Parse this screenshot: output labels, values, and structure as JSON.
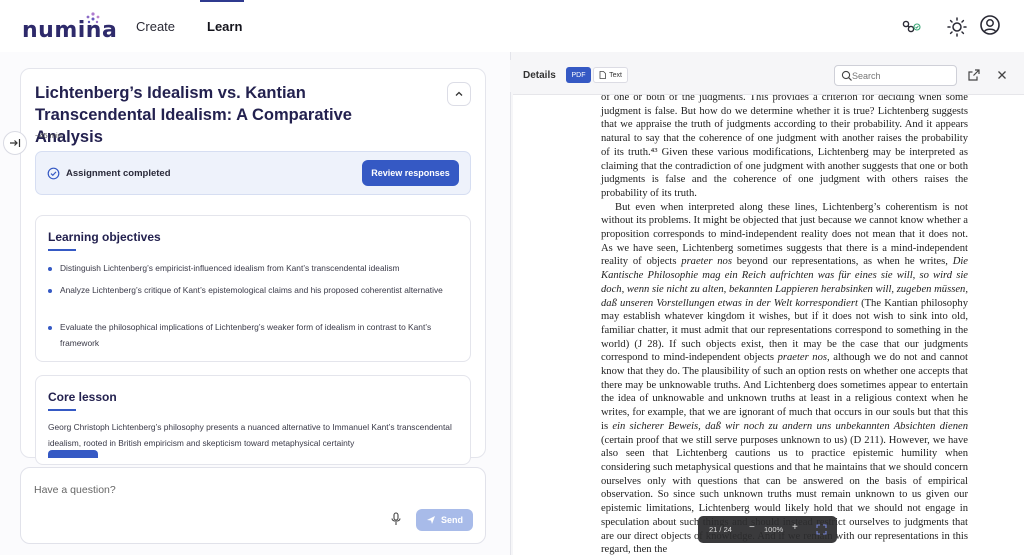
{
  "header": {
    "logo_text": "numina",
    "nav": {
      "create": "Create",
      "learn": "Learn"
    },
    "icons": [
      "connection-status-icon",
      "theme-sun-icon",
      "user-account-icon"
    ],
    "accent_color": "#2f3a8f"
  },
  "lesson": {
    "title": "Lichtenberg’s Idealism vs. Kantian Transcendental Idealism: A Comparative Analysis",
    "duration": "~45 min",
    "assignment_status": "Assignment completed",
    "review_label": "Review responses",
    "objectives_title": "Learning objectives",
    "objectives": [
      "Distinguish Lichtenberg’s empiricist-influenced idealism from Kant’s transcendental idealism",
      "Analyze Lichtenberg’s critique of Kant’s epistemological claims and his proposed coherentist alternative",
      "Evaluate the philosophical implications of Lichtenberg’s weaker form of idealism in contrast to Kant’s framework"
    ],
    "core_title": "Core lesson",
    "core_text": "Georg Christoph Lichtenberg’s philosophy presents a nuanced alternative to Immanuel Kant’s transcendental idealism, rooted in British empiricism and skepticism toward metaphysical certainty"
  },
  "ask": {
    "placeholder": "Have a question?",
    "send_label": "Send"
  },
  "details": {
    "label": "Details",
    "tab_pdf": "PDF",
    "tab_text": "Text",
    "search_placeholder": "Search"
  },
  "pdf": {
    "page_indicator": "21 / 24",
    "zoom": "100%",
    "minus": "−",
    "plus": "+",
    "para1": "of one or both of the judgments. This provides a criterion for deciding when some judgment is false. But how do we determine whether it is true? Lichtenberg suggests that we appraise the truth of judgments according to their probability. And it appears natural to say that the coherence of one judgment with another raises the probability of its truth.⁴³ Given these various modifications, Lichtenberg may be interpreted as claiming that the contradiction of one judgment with another suggests that one or both judgments is false and the coherence of one judgment with others raises the probability of its truth.",
    "para2_a": "But even when interpreted along these lines, Lichtenberg’s coherentism is not without its problems. It might be objected that just because we cannot know whether a proposition corresponds to mind-independent reality does not mean that it does not. As we have seen, Lichtenberg sometimes suggests that there is a mind-independent reality of objects ",
    "para2_it1": "praeter nos",
    "para2_b": " beyond our representations, as when he writes, ",
    "para2_it2": "Die Kantische Philosophie mag ein Reich aufrichten was für eines sie will, so wird sie doch, wenn sie nicht zu alten, bekannten Lappieren herabsinken will, zugeben müssen, daß unseren Vorstellungen etwas in der Welt korrespondiert",
    "para2_c": " (The Kantian philosophy may establish whatever kingdom it wishes, but if it does not wish to sink into old, familiar chatter, it must admit that our representations correspond to something in the world) (J 28). If such objects exist, then it may be the case that our judgments correspond to mind-independent objects ",
    "para2_it3": "praeter nos,",
    "para2_d": " although we do not and cannot know that they do. The plausibility of such an option rests on whether one accepts that there may be unknowable truths. And Lichtenberg does sometimes appear to entertain the idea of unknowable and unknown truths at least in a religious context when he writes, for example, that we are ignorant of much that occurs in our souls but that this is ",
    "para2_it4": "ein sicherer Beweis, daß wir noch zu andern uns unbekannten Absichten dienen",
    "para2_e": " (certain proof that we still serve purposes unknown to us) (D 211). However, we have also seen that Lichtenberg cautions us to practice epistemic humility when considering such metaphysical questions and that he maintains that we should concern ourselves only with questions that can be answered on the basis of empirical observation. So since such unknown truths must remain unknown to us given our epistemic limitations, Lichtenberg would likely hold that we should not engage in speculation about such things and should instead restrict ourselves to judgments that are our direct objects of knowledge. And if we remain with our representations in this regard, then the"
  }
}
